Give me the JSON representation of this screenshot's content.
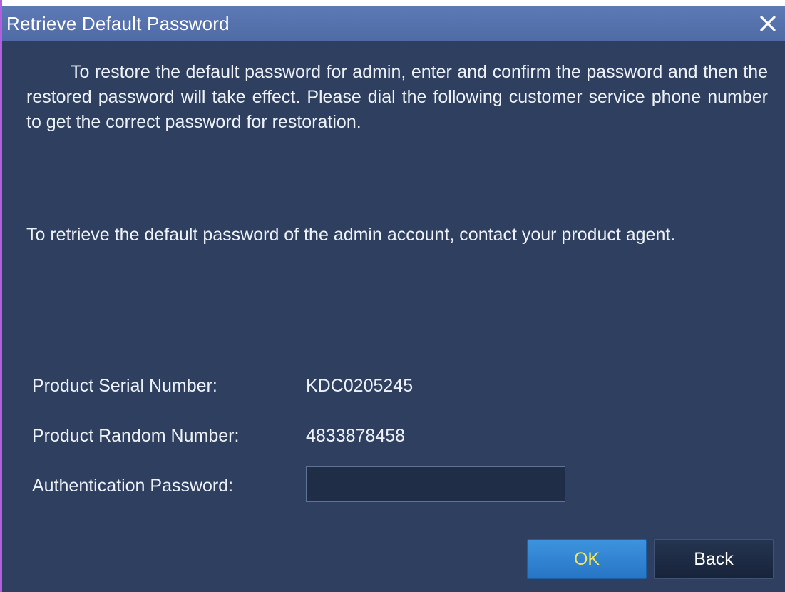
{
  "dialog": {
    "title": "Retrieve Default Password",
    "close_icon": "close-icon"
  },
  "content": {
    "paragraph1": "To restore the default password for admin, enter and confirm the password and then the restored password will take effect. Please dial the following customer service phone number to get the correct password for restoration.",
    "paragraph2": "To retrieve the default password of the admin account, contact your product agent."
  },
  "fields": {
    "serial_label": "Product Serial Number:",
    "serial_value": "KDC0205245",
    "random_label": "Product Random Number:",
    "random_value": "4833878458",
    "auth_label": "Authentication Password:",
    "auth_value": ""
  },
  "buttons": {
    "ok_label": "OK",
    "back_label": "Back"
  },
  "colors": {
    "background": "#2e3f5f",
    "titlebar": "#5874b0",
    "ok_button": "#3183d2",
    "ok_text": "#f2e45c",
    "back_button": "#1f2d46"
  }
}
